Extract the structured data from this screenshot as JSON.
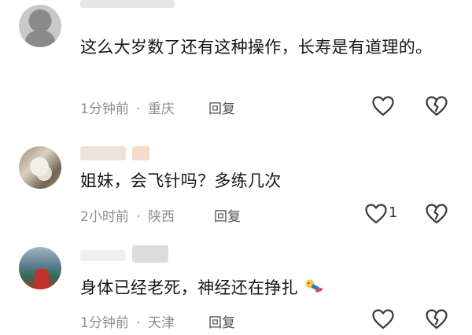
{
  "comments": [
    {
      "text": "这么大岁数了还有这种操作，长寿是有道理的。",
      "time": "1分钟前",
      "sep": "·",
      "location": "重庆",
      "reply": "回复",
      "likes": ""
    },
    {
      "text": "姐妹，会飞针吗？多练几次",
      "time": "2小时前",
      "sep": "·",
      "location": "陕西",
      "reply": "回复",
      "likes": "1"
    },
    {
      "text": "身体已经老死，神经还在挣扎",
      "time": "1分钟前",
      "sep": "·",
      "location": "天津",
      "reply": "回复",
      "likes": ""
    }
  ],
  "icons": {
    "like": "heart-outline-icon",
    "dislike": "broken-heart-icon",
    "emoji": "running-figure-emoji"
  },
  "colors": {
    "text": "#161616",
    "meta": "#8e8e8e",
    "icon": "#3a3a3a"
  }
}
